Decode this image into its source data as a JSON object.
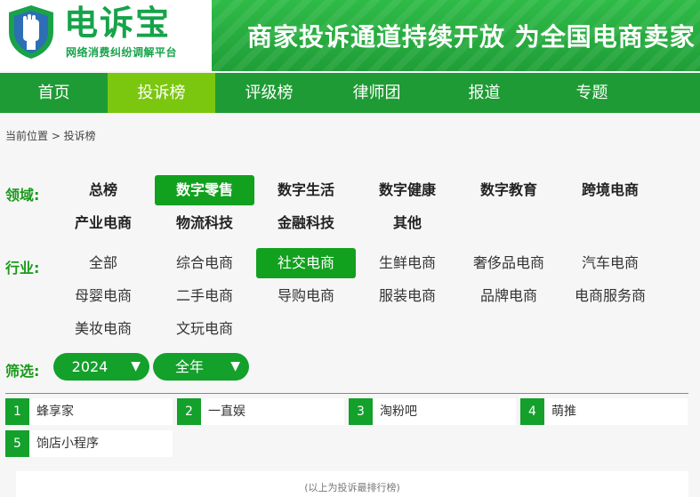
{
  "header": {
    "brand": "电诉宝",
    "brand_sub": "网络消费纠纷调解平台",
    "banner_text": "商家投诉通道持续开放 为全国电商卖家"
  },
  "nav": [
    "首页",
    "投诉榜",
    "评级榜",
    "律师团",
    "报道",
    "专题"
  ],
  "breadcrumb": "当前位置 > 投诉榜",
  "filters": {
    "domain_label": "领域:",
    "domains": [
      "总榜",
      "数字零售",
      "数字生活",
      "数字健康",
      "数字教育",
      "跨境电商",
      "产业电商",
      "物流科技",
      "金融科技",
      "其他"
    ],
    "industry_label": "行业:",
    "industries": [
      "全部",
      "综合电商",
      "社交电商",
      "生鲜电商",
      "奢侈品电商",
      "汽车电商",
      "母婴电商",
      "二手电商",
      "导购电商",
      "服装电商",
      "品牌电商",
      "电商服务商",
      "美妆电商",
      "文玩电商"
    ],
    "screen_label": "筛选:",
    "year": "2024",
    "period": "全年"
  },
  "ranking": [
    {
      "num": "1",
      "name": "蜂享家"
    },
    {
      "num": "2",
      "name": "一直娱"
    },
    {
      "num": "3",
      "name": "淘粉吧"
    },
    {
      "num": "4",
      "name": "萌推"
    },
    {
      "num": "5",
      "name": "饷店小程序"
    }
  ],
  "footer_note": "(以上为投诉最排行榜)",
  "colors": {
    "primary_green": "#1e9b34",
    "active_nav": "#7bc70f",
    "chip_active": "#11a11e"
  }
}
